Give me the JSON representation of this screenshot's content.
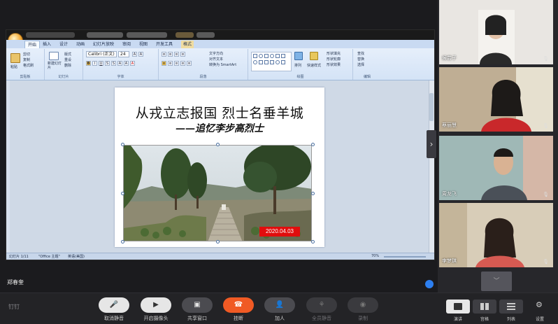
{
  "colors": {
    "accent_red": "#f05a24",
    "badge_red": "#e10d0d",
    "panel_bg": "#27272b"
  },
  "ppt": {
    "tabs": [
      "开始",
      "插入",
      "设计",
      "动画",
      "幻灯片放映",
      "审阅",
      "视图",
      "开发工具",
      "格式"
    ],
    "groups": {
      "clipboard": "剪贴板",
      "slides": "幻灯片",
      "font": "字体",
      "paragraph": "段落",
      "drawing": "绘图",
      "editing": "编辑"
    },
    "clipboard_items": [
      "剪切",
      "复制",
      "格式刷"
    ],
    "paste": "粘贴",
    "new_slide": "新建幻灯片",
    "slide_items": [
      "版式",
      "重设",
      "删除"
    ],
    "font_name": "Calibri (正文)",
    "font_size": "24",
    "para_items": [
      "文字方向",
      "对齐文本",
      "转换为 SmartArt"
    ],
    "drawing_items": [
      "排列",
      "快速样式",
      "形状填充",
      "形状轮廓",
      "形状效果"
    ],
    "editing_items": [
      "查找",
      "替换",
      "选择"
    ],
    "slide_title": "从戎立志报国  烈士名垂羊城",
    "slide_subtitle": "——追忆李步高烈士",
    "photo_date": "2020.04.03",
    "status_slide": "幻灯片 1/11",
    "status_theme": "\"Office 主题\"",
    "status_lang": "英语(美国)",
    "zoom": "70%"
  },
  "presenter_name": "郑春奎",
  "participants": [
    {
      "name": "候芸子"
    },
    {
      "name": "蔡丽慧"
    },
    {
      "name": "周龙飞"
    },
    {
      "name": "李梦琪"
    }
  ],
  "toolbar": {
    "brand": "钉钉",
    "buttons": [
      {
        "label": "取消静音",
        "icon": "mic-off-icon"
      },
      {
        "label": "开启摄像头",
        "icon": "camera-off-icon"
      },
      {
        "label": "共享窗口",
        "icon": "share-window-icon"
      },
      {
        "label": "挂断",
        "icon": "hangup-icon"
      },
      {
        "label": "加人",
        "icon": "add-person-icon"
      },
      {
        "label": "全员静音",
        "icon": "mute-all-icon"
      },
      {
        "label": "录制",
        "icon": "record-icon"
      }
    ],
    "views": [
      {
        "label": "演讲",
        "icon": "speaker-view-icon"
      },
      {
        "label": "宫格",
        "icon": "grid-view-icon"
      },
      {
        "label": "列表",
        "icon": "list-view-icon"
      }
    ],
    "settings": "设置"
  }
}
